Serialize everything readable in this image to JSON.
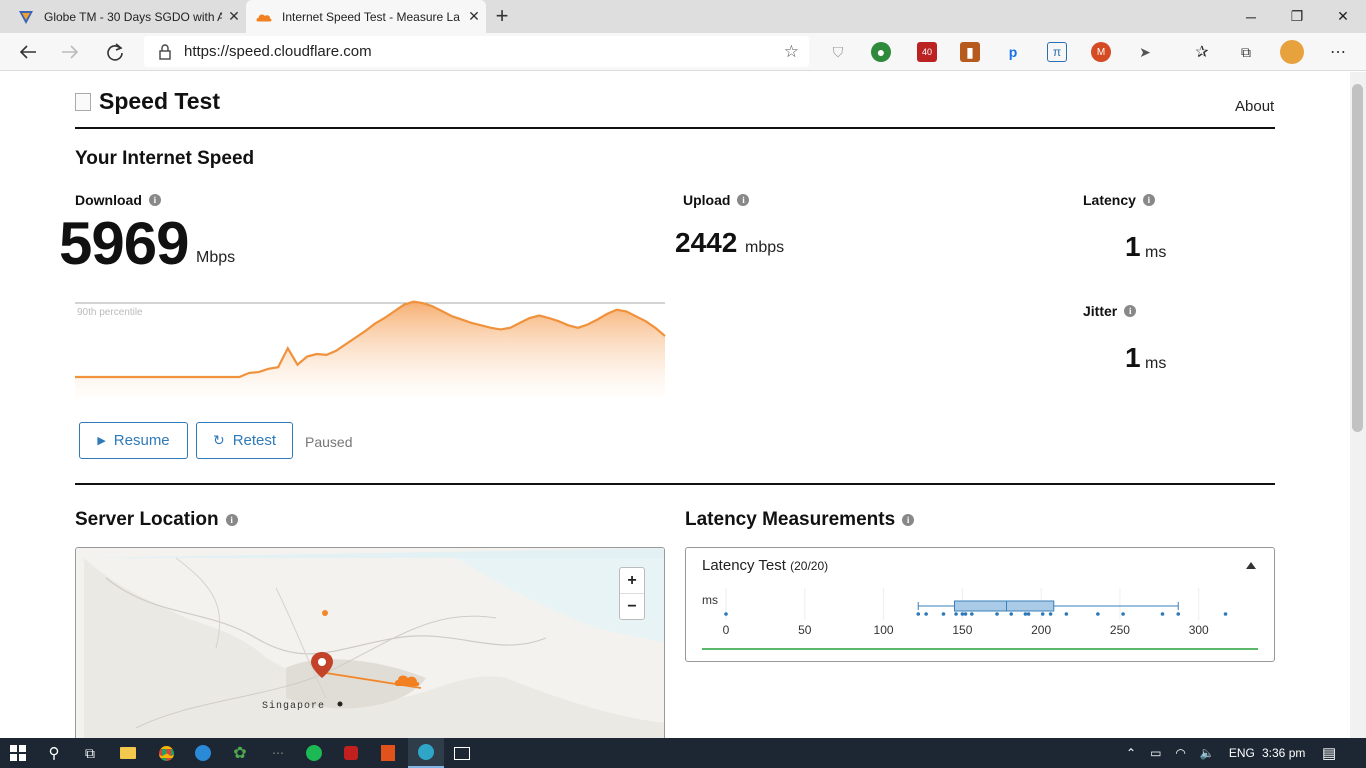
{
  "browser": {
    "tabs": [
      {
        "title": "Globe TM - 30 Days SGDO with A",
        "active": false
      },
      {
        "title": "Internet Speed Test - Measure La",
        "active": true
      }
    ],
    "url": "https://speed.cloudflare.com",
    "window_controls": [
      "minimize-icon",
      "restore-icon",
      "close-icon"
    ],
    "extension_badge": "40"
  },
  "site": {
    "title": "Speed Test",
    "about_link": "About"
  },
  "speed": {
    "heading": "Your Internet Speed",
    "download": {
      "label": "Download",
      "value": "5969",
      "unit": "Mbps"
    },
    "upload": {
      "label": "Upload",
      "value": "2442",
      "unit": "mbps"
    },
    "latency": {
      "label": "Latency",
      "value": "1",
      "unit": "ms"
    },
    "jitter": {
      "label": "Jitter",
      "value": "1",
      "unit": "ms"
    },
    "percentile_label": "90th percentile",
    "resume_label": "Resume",
    "retest_label": "Retest",
    "status": "Paused"
  },
  "server": {
    "heading": "Server Location",
    "city_label": "Singapore",
    "zoom_in": "+",
    "zoom_out": "−"
  },
  "latency_panel": {
    "heading": "Latency Measurements",
    "test_title": "Latency Test",
    "test_count": "(20/20)"
  },
  "chart_data": [
    {
      "type": "area",
      "title": "",
      "series": [
        {
          "name": "Download",
          "values": [
            0.0,
            0.0,
            0.0,
            0.0,
            0.0,
            0.0,
            0.0,
            0.0,
            0.0,
            0.0,
            0.0,
            0.0,
            0.0,
            0.0,
            0.0,
            0.0,
            0.0,
            0.0,
            0.05,
            0.06,
            0.1,
            0.12,
            0.35,
            0.15,
            0.25,
            0.28,
            0.27,
            0.32,
            0.4,
            0.48,
            0.56,
            0.65,
            0.72,
            0.8,
            0.88,
            0.92,
            0.9,
            0.86,
            0.8,
            0.74,
            0.7,
            0.66,
            0.63,
            0.6,
            0.58,
            0.6,
            0.66,
            0.72,
            0.75,
            0.72,
            0.68,
            0.63,
            0.6,
            0.64,
            0.7,
            0.77,
            0.82,
            0.8,
            0.74,
            0.68,
            0.6,
            0.5
          ]
        }
      ],
      "annotations": [
        "90th percentile"
      ],
      "grid": false
    },
    {
      "type": "scatter",
      "title": "Latency Test (20/20)",
      "ylabel": "ms",
      "xlim": [
        0,
        330
      ],
      "ticks": [
        0,
        50,
        100,
        150,
        200,
        250,
        300
      ],
      "box": {
        "min": 122,
        "q1": 145,
        "median": 178,
        "q3": 208,
        "max": 287
      },
      "points": [
        0,
        122,
        127,
        138,
        146,
        150,
        152,
        156,
        172,
        181,
        190,
        192,
        201,
        206,
        216,
        236,
        252,
        277,
        287,
        317
      ]
    }
  ],
  "taskbar": {
    "language": "ENG",
    "time": "3:36 pm"
  }
}
